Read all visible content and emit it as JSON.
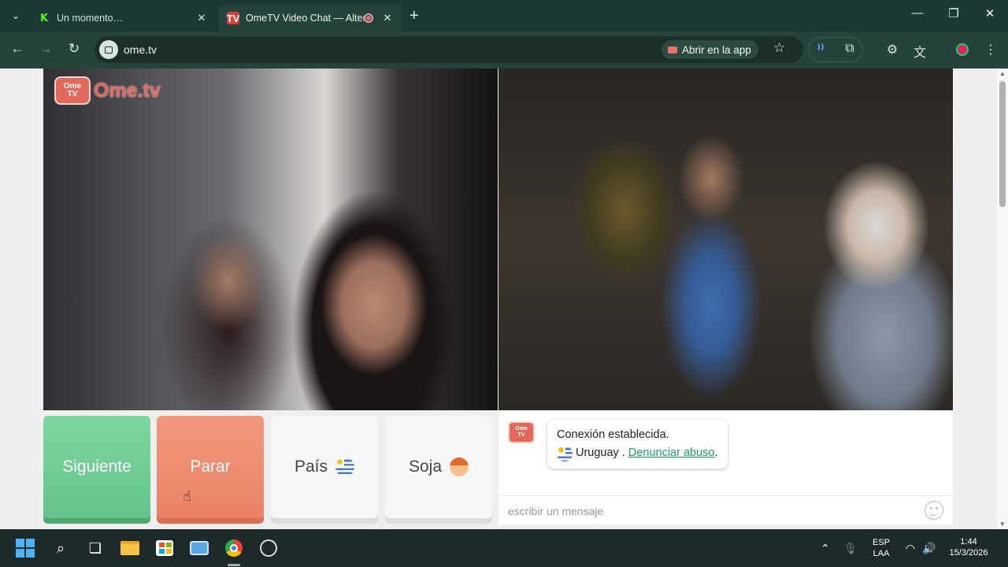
{
  "browser": {
    "tabs": [
      {
        "title": "Un momento…",
        "active": false
      },
      {
        "title": "OmeTV Video Chat — Alterna",
        "active": true
      }
    ],
    "url": "ome.tv",
    "open_app_label": "Abrir en la app"
  },
  "logo": {
    "badge_top": "Ome",
    "badge_bottom": "TV",
    "text": "Ome.tv"
  },
  "buttons": {
    "next": "Siguiente",
    "stop": "Parar",
    "country": "País",
    "gender": "Soja"
  },
  "chat": {
    "logo_top": "Ome",
    "logo_bottom": "TV",
    "status": "Conexión establecida.",
    "country": "Uruguay",
    "separator": ".",
    "report_link": "Denunciar abuso",
    "report_suffix": ".",
    "input_placeholder": "escribir un mensaje"
  },
  "taskbar": {
    "lang_top": "ESP",
    "lang_bottom": "LAA",
    "time": "1:44",
    "date": "15/3/2026"
  },
  "colors": {
    "next_green": "#6acb92",
    "stop_orange": "#ee8b6f",
    "brand": "#e2685b",
    "link_green": "#1aa261"
  }
}
